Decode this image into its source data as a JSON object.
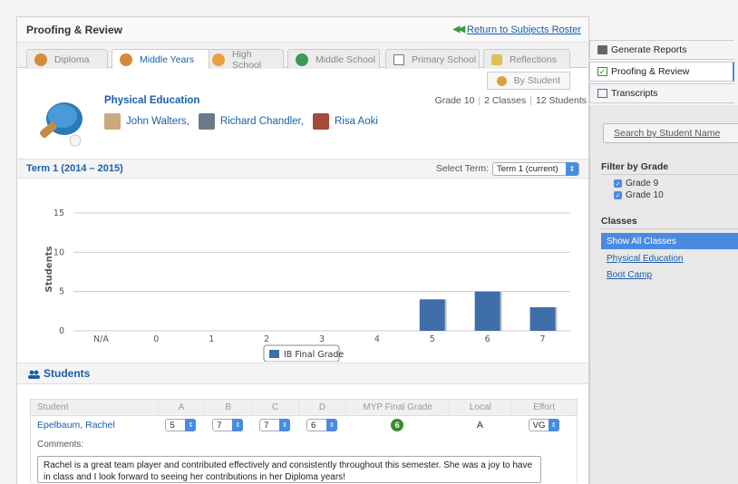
{
  "header": {
    "title": "Proofing & Review",
    "return_link": "Return to Subjects Roster"
  },
  "tabs": [
    {
      "label": "Diploma",
      "icon": "diploma-icon",
      "color": "#d88a3a"
    },
    {
      "label": "Middle Years",
      "icon": "middle-years-icon",
      "color": "#d88a3a"
    },
    {
      "label": "High School",
      "icon": "high-school-icon",
      "color": "#e8a040"
    },
    {
      "label": "Middle School",
      "icon": "middle-school-icon",
      "color": "#3a9a5a"
    },
    {
      "label": "Primary School",
      "icon": "primary-school-icon",
      "color": "#777777"
    },
    {
      "label": "Reflections",
      "icon": "pencil-icon",
      "color": "#e0c050"
    }
  ],
  "by_student": "By Student",
  "course": {
    "title": "Physical Education",
    "grade": "Grade 10",
    "classes": "2 Classes",
    "students": "12 Students",
    "teachers": [
      "John Walters,",
      "Richard Chandler,",
      "Risa Aoki"
    ]
  },
  "term": {
    "title": "Term 1 (2014 – 2015)",
    "select_label": "Select Term:",
    "select_value": "Term 1 (current)"
  },
  "chart_data": {
    "type": "bar",
    "categories": [
      "N/A",
      "0",
      "1",
      "2",
      "3",
      "4",
      "5",
      "6",
      "7"
    ],
    "series": [
      {
        "name": "IB Final Grade",
        "values": [
          0,
          0,
          0,
          0,
          0,
          0,
          4,
          5,
          3
        ],
        "color": "#3f6ea8"
      }
    ],
    "ylabel": "Students",
    "xlabel": "",
    "ylim": [
      0,
      15
    ],
    "yticks": [
      0,
      5,
      10,
      15
    ],
    "grid": true,
    "legend": "bottom-center"
  },
  "students_section": {
    "title": "Students"
  },
  "table": {
    "headers": [
      "Student",
      "A",
      "B",
      "C",
      "D",
      "MYP Final Grade",
      "Local",
      "Effort"
    ],
    "rows": [
      {
        "name": "Epelbaum, Rachel",
        "a": "5",
        "b": "7",
        "c": "7",
        "d": "6",
        "final": "6",
        "local": "A",
        "effort": "VG"
      }
    ],
    "comments_label": "Comments:",
    "comment": "Rachel is a great team player and contributed effectively and consistently throughout this semester. She was a joy to have in class and I look forward to seeing her contributions in her Diploma years!"
  },
  "sidebar": {
    "tabs": [
      "Generate Reports",
      "Proofing & Review",
      "Transcripts"
    ],
    "search": "Search by Student Name",
    "filter_title": "Filter by Grade",
    "grades": [
      "Grade 9",
      "Grade 10"
    ],
    "classes_title": "Classes",
    "classes": [
      "Show All Classes",
      "Physical Education",
      "Boot Camp"
    ]
  }
}
